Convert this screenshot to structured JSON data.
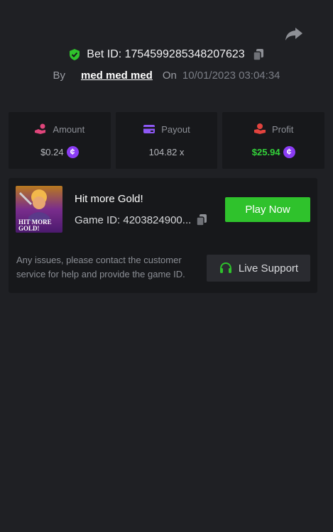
{
  "header": {
    "bet_id_label": "Bet ID: 1754599285348207623",
    "by_label": "By",
    "username": "med med med",
    "on_label": "On",
    "datetime": "10/01/2023 03:04:34"
  },
  "stats": {
    "amount": {
      "label": "Amount",
      "value": "$0.24",
      "icon": "hand-coin-icon",
      "color": "#e0457b"
    },
    "payout": {
      "label": "Payout",
      "value": "104.82 x",
      "icon": "card-icon",
      "color": "#8e58f6"
    },
    "profit": {
      "label": "Profit",
      "value": "$25.94",
      "icon": "money-hand-icon",
      "color": "#e2433e"
    }
  },
  "game": {
    "title": "Hit more Gold!",
    "game_id_label": "Game ID: 4203824900...",
    "play_button": "Play Now",
    "thumb_text_line1": "HIT MORE",
    "thumb_text_line2": "GOLD!",
    "help_text": "Any issues, please contact the customer service for help and provide the game ID.",
    "support_button": "Live Support"
  },
  "colors": {
    "background": "#1f2024",
    "card": "#17181b",
    "accent_green": "#2fc22c",
    "coin_purple": "#8b3cf4",
    "profit_green": "#33d23a"
  },
  "icons": [
    "share-icon",
    "shield-check-icon",
    "copy-icon",
    "coin-icon",
    "headset-icon"
  ]
}
